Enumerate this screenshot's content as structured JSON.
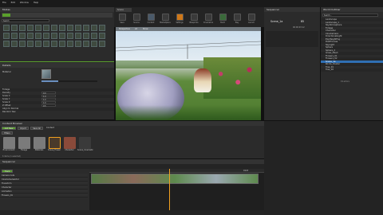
{
  "menu": {
    "items": [
      "File",
      "Edit",
      "Window",
      "Help"
    ]
  },
  "toolbar": {
    "tab_label": "Scene",
    "buttons": [
      "Save",
      "Source",
      "Content",
      "Marketplace",
      "Settings",
      "Blueprints",
      "Cinematics",
      "Build",
      "Play",
      "Launch"
    ]
  },
  "modes": {
    "header": "Modes",
    "search_placeholder": "Search"
  },
  "details": {
    "header": "Details",
    "section": "Material",
    "rows": [
      "Material",
      "Foliage",
      "Density",
      "Scale X",
      "Scale Y",
      "Scale Z",
      "Z Offset",
      "Align to Normal",
      "Random Yaw",
      "Ground Slope"
    ],
    "values": [
      "0.0",
      "1.0",
      "1.0",
      "1.0",
      "0.5"
    ]
  },
  "viewport": {
    "mode_label": "Perspective",
    "lit_label": "Lit",
    "show_label": "Show"
  },
  "sequencer_side": {
    "header": "Sequencer",
    "scene_name": "Scene_1a",
    "time_value": "85",
    "timecode": "00:00:03:12"
  },
  "outliner": {
    "header": "World Outliner",
    "search_placeholder": "Search...",
    "actors": [
      "Landscape",
      "Landscape_1",
      "SkyAtmosphere",
      "Foliage",
      "Character",
      "CineCamera",
      "DirectionalLight",
      "ExpHeightFog",
      "PostProcess",
      "SkyLight",
      "Sphere",
      "Sphere_2",
      "Grass_Mesh",
      "Flowers_01",
      "Flowers_02",
      "Scene_1a",
      "Rocks_Cluster",
      "Tree_01",
      "Tree_02"
    ],
    "footer": "19 actors"
  },
  "content": {
    "header": "Content Browser",
    "add_label": "Add New",
    "import_label": "Import",
    "save_label": "Save All",
    "path": "Content",
    "filter_label": "Filters",
    "assets": [
      "Environment",
      "Foliage",
      "Materials",
      "Scene_Flower",
      "Character",
      "Scene_Cinematic"
    ],
    "footer": "6 items (1 selected)"
  },
  "sequencer": {
    "header": "Sequencer",
    "track_btn": "Track",
    "tracks": [
      "Camera Cuts",
      "CineCameraActor",
      "Transform",
      "Character",
      "Animation",
      "Flowers_01"
    ],
    "timecode_right": "0143"
  },
  "colors": {
    "accent": "#f0a020",
    "selection": "#2f6fb3",
    "play_green": "#4caf50"
  }
}
